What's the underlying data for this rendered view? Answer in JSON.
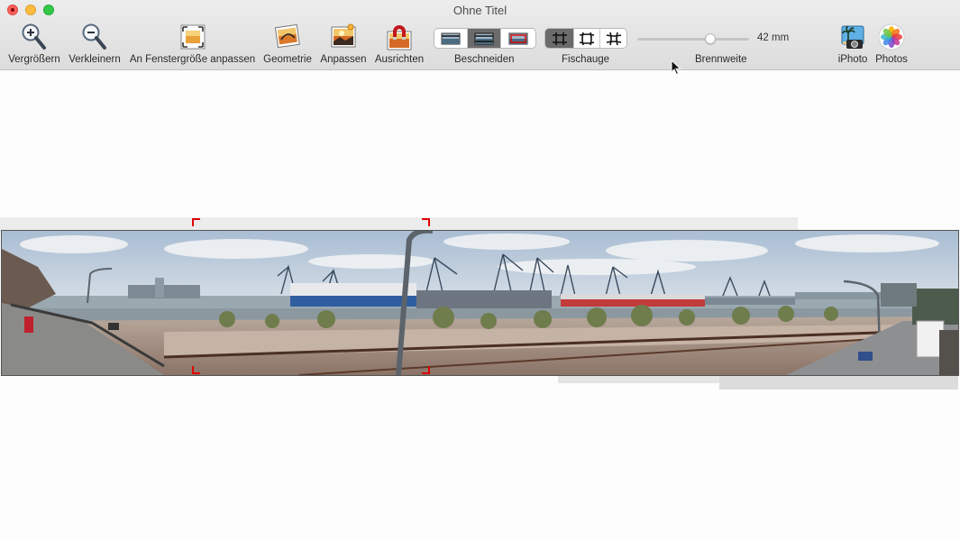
{
  "window": {
    "title": "Ohne Titel"
  },
  "toolbar": {
    "zoom_in": "Vergrößern",
    "zoom_out": "Verkleinern",
    "fit_window": "An Fenstergröße anpassen",
    "geometry": "Geometrie",
    "adjust": "Anpassen",
    "align": "Ausrichten",
    "crop_label": "Beschneiden",
    "fisheye_label": "Fischauge",
    "focal_label": "Brennweite",
    "focal_value": "42 mm",
    "focal_level": 0.65,
    "iphoto": "iPhoto",
    "photos": "Photos",
    "crop_selected": 1,
    "fisheye_selected": 0
  },
  "colors": {
    "selection_corner": "#e00000",
    "segment_selected": "#6b6b6b"
  }
}
